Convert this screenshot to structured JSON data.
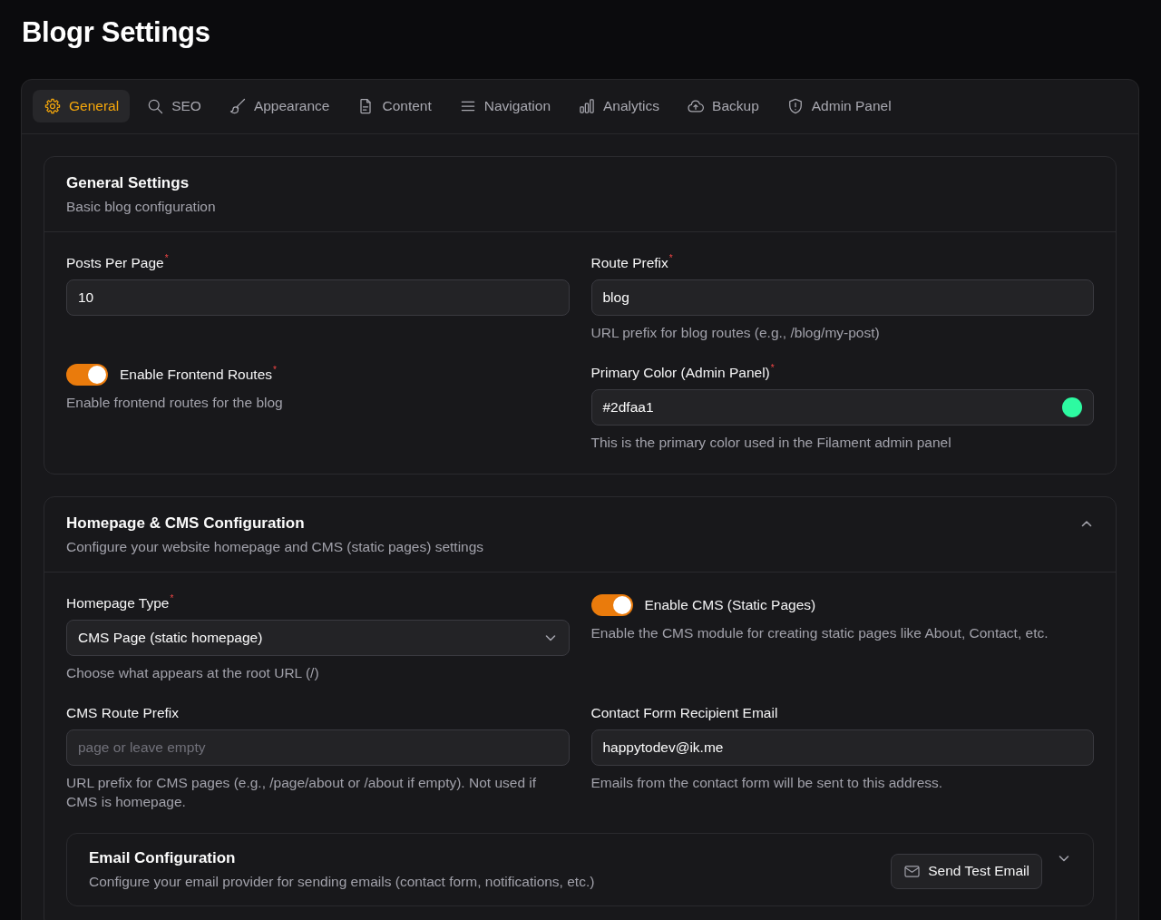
{
  "page": {
    "title": "Blogr Settings"
  },
  "tabs": [
    {
      "label": "General",
      "selected": true
    },
    {
      "label": "SEO",
      "selected": false
    },
    {
      "label": "Appearance",
      "selected": false
    },
    {
      "label": "Content",
      "selected": false
    },
    {
      "label": "Navigation",
      "selected": false
    },
    {
      "label": "Analytics",
      "selected": false
    },
    {
      "label": "Backup",
      "selected": false
    },
    {
      "label": "Admin Panel",
      "selected": false
    }
  ],
  "sections": [
    {
      "title": "General Settings",
      "description": "Basic blog configuration",
      "collapsible": false,
      "fields": [
        {
          "kind": "text",
          "label": "Posts Per Page$^{*}$",
          "value": "10"
        },
        {
          "kind": "text",
          "label": "Route Prefix$^{*}$",
          "value": "blog",
          "hint": "URL prefix for blog routes (e.g., /blog/my-post)"
        },
        {
          "kind": "toggle",
          "label": "Enable Frontend Routes$^{*}$",
          "on": true,
          "hint": "Enable frontend routes for the blog"
        },
        {
          "kind": "color",
          "label": "Primary Color (Admin Panel)$^{*}$",
          "value": "#2dfaa1",
          "hint": "This is the primary color used in the Filament admin panel"
        }
      ]
    },
    {
      "title": "Homepage & CMS Configuration",
      "description": "Configure your website homepage and CMS (static pages) settings",
      "collapsible": true,
      "expanded": true,
      "fields": [
        {
          "kind": "select",
          "label": "Homepage Type$^{*}$",
          "value": "CMS Page (static homepage)",
          "hint": "Choose what appears at the root URL (/)"
        },
        {
          "kind": "toggle",
          "label": "Enable CMS (Static Pages)",
          "on": true,
          "hint": "Enable the CMS module for creating static pages like About, Contact, etc."
        },
        {
          "kind": "text",
          "label": "CMS Route Prefix",
          "placeholder": "page or leave empty",
          "hint": "URL prefix for CMS pages (e.g., /page/about or /about if empty). Not used if CMS is homepage."
        },
        {
          "kind": "text",
          "label": "Contact Form Recipient Email",
          "value": "happytodev@ik.me",
          "hint": "Emails from the contact form will be sent to this address."
        }
      ],
      "subsections": [
        {
          "title": "Email Configuration",
          "description": "Configure your email provider for sending emails (contact form, notifications, etc.)",
          "collapsible": true,
          "expanded": false,
          "action": {
            "label": "Send Test Email"
          }
        }
      ]
    }
  ]
}
